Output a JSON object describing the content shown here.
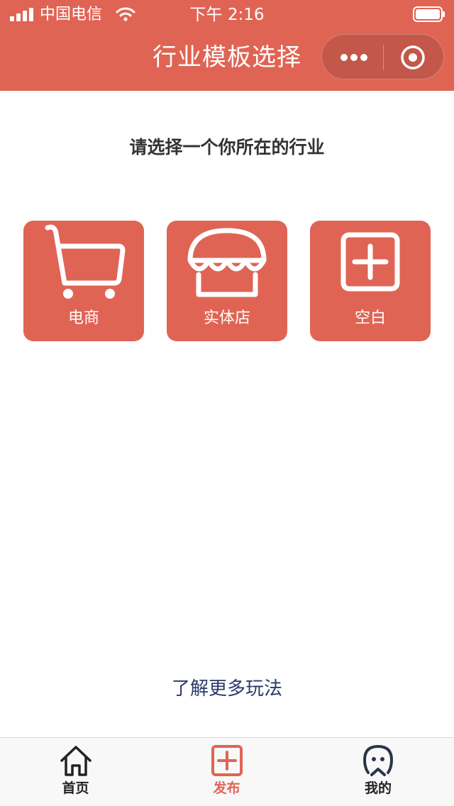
{
  "status_bar": {
    "carrier": "中国电信",
    "time": "下午 2:16"
  },
  "nav": {
    "title": "行业模板选择",
    "more_icon": "more-dots-icon",
    "close_icon": "target-circle-icon"
  },
  "main": {
    "prompt": "请选择一个你所在的行业",
    "tiles": [
      {
        "label": "电商",
        "icon": "shopping-cart-icon"
      },
      {
        "label": "实体店",
        "icon": "storefront-icon"
      },
      {
        "label": "空白",
        "icon": "plus-square-icon"
      }
    ],
    "learn_more": "了解更多玩法"
  },
  "tabbar": {
    "items": [
      {
        "label": "首页",
        "icon": "home-icon",
        "active": false
      },
      {
        "label": "发布",
        "icon": "plus-square-icon",
        "active": true
      },
      {
        "label": "我的",
        "icon": "user-face-icon",
        "active": false
      }
    ]
  },
  "colors": {
    "brand": "#e06454",
    "link": "#2a3a6b",
    "text": "#333333"
  }
}
